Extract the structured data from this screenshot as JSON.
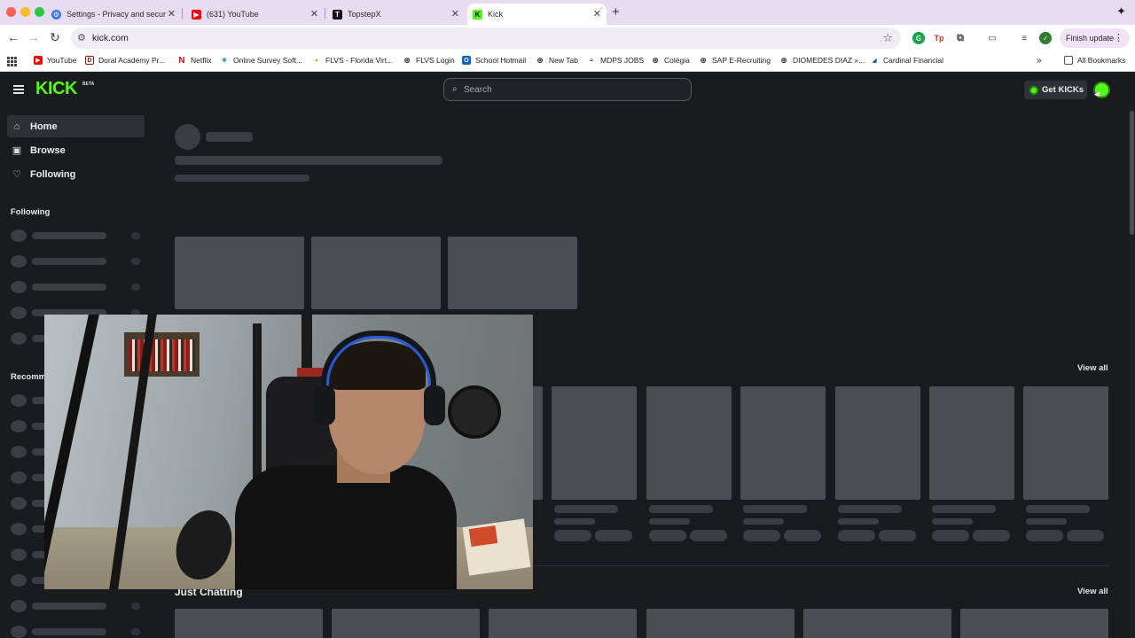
{
  "browser": {
    "tabs": [
      {
        "title": "Settings - Privacy and securi",
        "icon": "gear-icon",
        "active": false
      },
      {
        "title": "(631) YouTube",
        "icon": "youtube-icon",
        "active": false
      },
      {
        "title": "TopstepX",
        "icon": "topstepx-icon",
        "active": false
      },
      {
        "title": "Kick",
        "icon": "kick-icon",
        "active": true
      }
    ],
    "url": "kick.com",
    "finish_update": "Finish update",
    "bookmarks": [
      {
        "label": "YouTube",
        "icon": "youtube-icon"
      },
      {
        "label": "Doral Academy Pr...",
        "icon": "doral-icon"
      },
      {
        "label": "Netflix",
        "icon": "netflix-icon"
      },
      {
        "label": "Online Survey Soft...",
        "icon": "survey-icon"
      },
      {
        "label": "FLVS - Florida Virt...",
        "icon": "flvs-icon"
      },
      {
        "label": "FLVS Login",
        "icon": "globe-icon"
      },
      {
        "label": "School Hotmail",
        "icon": "outlook-icon"
      },
      {
        "label": "New Tab",
        "icon": "globe-icon"
      },
      {
        "label": "MDPS JOBS",
        "icon": "mdps-icon"
      },
      {
        "label": "Colégia",
        "icon": "globe-icon"
      },
      {
        "label": "SAP E-Recruiting",
        "icon": "globe-icon"
      },
      {
        "label": "DIOMEDES DIAZ »...",
        "icon": "globe-icon"
      },
      {
        "label": "Cardinal Financial",
        "icon": "cardinal-icon"
      }
    ],
    "all_bookmarks": "All Bookmarks",
    "colors": {
      "tabbar": "#e8dcf2",
      "active_tab": "#ffffff"
    }
  },
  "kick": {
    "logo": "KICK",
    "beta": "BETA",
    "search_placeholder": "Search",
    "get_kicks": "Get KICKs",
    "accent": "#53fc18",
    "nav": [
      {
        "label": "Home",
        "icon": "home-icon"
      },
      {
        "label": "Browse",
        "icon": "browse-icon"
      },
      {
        "label": "Following",
        "icon": "heart-icon"
      }
    ],
    "following_heading": "Following",
    "recommended_heading": "Recomm",
    "sections": [
      {
        "title": "",
        "view_all": "View all"
      },
      {
        "title": "Just Chatting",
        "view_all": "View all"
      }
    ]
  }
}
